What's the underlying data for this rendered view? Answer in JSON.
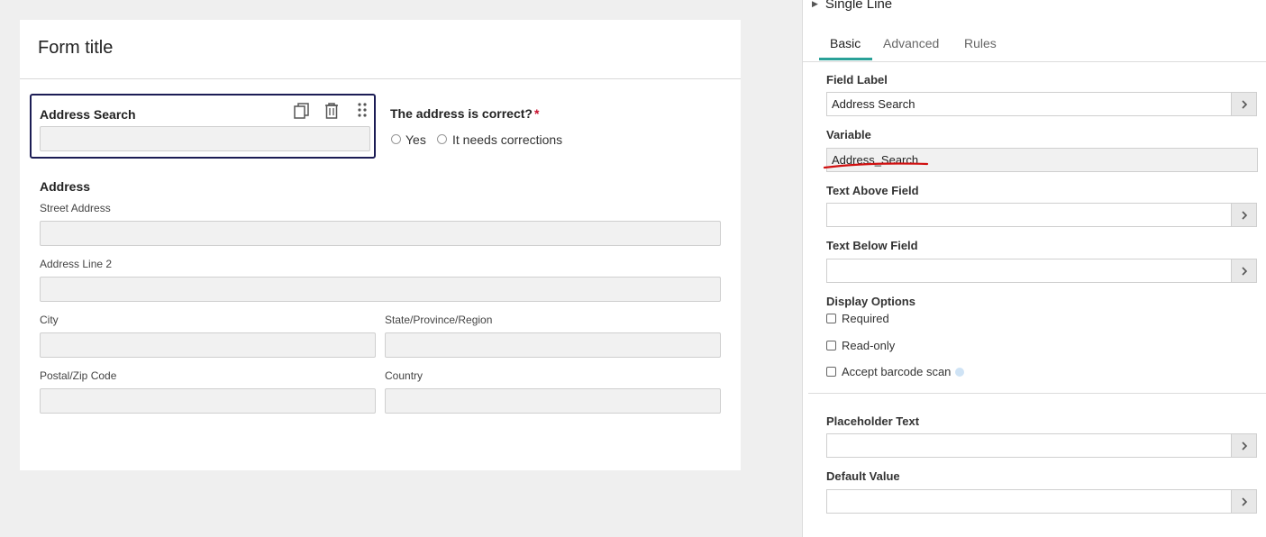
{
  "form": {
    "title": "Form title",
    "address_search": {
      "label": "Address Search"
    },
    "address_correct": {
      "label": "The address is correct?",
      "required_mark": "*",
      "options": [
        "Yes",
        "It needs corrections"
      ]
    },
    "address": {
      "heading": "Address",
      "street": "Street Address",
      "line2": "Address Line 2",
      "city": "City",
      "state": "State/Province/Region",
      "postal": "Postal/Zip Code",
      "country": "Country"
    }
  },
  "panel": {
    "header": "Single Line",
    "tabs": [
      "Basic",
      "Advanced",
      "Rules"
    ],
    "field_label": {
      "label": "Field Label",
      "value": "Address Search"
    },
    "variable": {
      "label": "Variable",
      "value": "Address_Search"
    },
    "text_above": {
      "label": "Text Above Field",
      "value": ""
    },
    "text_below": {
      "label": "Text Below Field",
      "value": ""
    },
    "display_options": {
      "label": "Display Options",
      "required": "Required",
      "readonly": "Read-only",
      "barcode": "Accept barcode scan"
    },
    "placeholder": {
      "label": "Placeholder Text",
      "value": ""
    },
    "default_value": {
      "label": "Default Value",
      "value": ""
    }
  },
  "colors": {
    "accent_tab": "#2aa198",
    "selected_border": "#1c1d55",
    "required": "#c8102e",
    "annotation": "#d01010"
  }
}
